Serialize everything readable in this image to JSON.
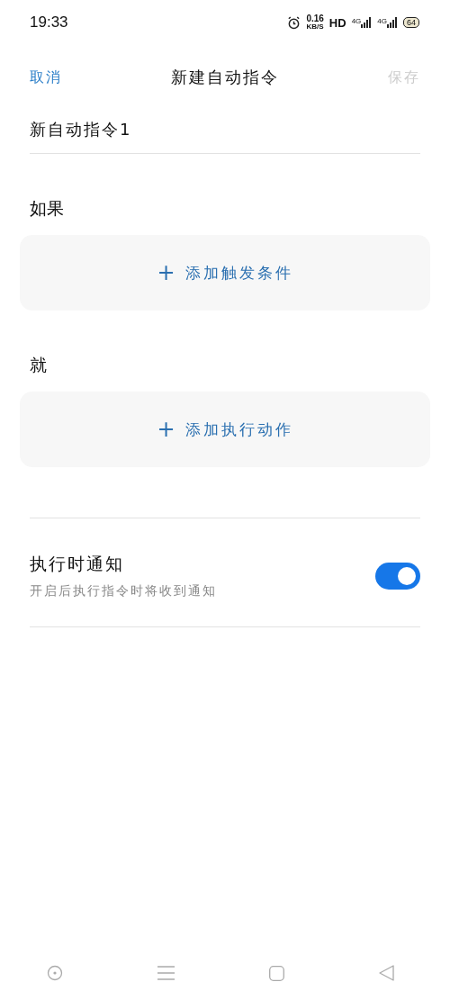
{
  "status_bar": {
    "time": "19:33",
    "speed": "0.16",
    "speed_unit": "KB/S",
    "hd": "HD",
    "networks": [
      "4G",
      "4G"
    ],
    "battery": "64"
  },
  "header": {
    "cancel": "取消",
    "title": "新建自动指令",
    "save": {
      "label": "保存",
      "disabled": true
    }
  },
  "name_field": {
    "value": "新自动指令1"
  },
  "sections": [
    {
      "label": "如果",
      "action": {
        "icon": "+",
        "label": "添加触发条件"
      }
    },
    {
      "label": "就",
      "action": {
        "icon": "+",
        "label": "添加执行动作"
      }
    }
  ],
  "notify": {
    "title": "执行时通知",
    "subtitle": "开启后执行指令时将收到通知",
    "on": true
  }
}
